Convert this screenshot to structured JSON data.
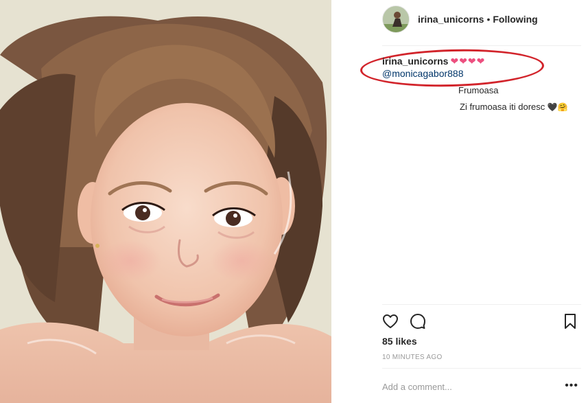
{
  "header": {
    "username": "irina_unicorns",
    "separator": "•",
    "follow_state": "Following",
    "avatar_icon": "avatar-photo"
  },
  "caption": {
    "username": "irina_unicorns",
    "hearts": "❤❤❤❤",
    "mention": "@monicagabor888"
  },
  "comments": [
    {
      "text": "Frumoasa"
    },
    {
      "text": "Zi frumoasa iti doresc",
      "emoji": "🖤🤗"
    }
  ],
  "actions": {
    "like_icon": "heart-outline-icon",
    "comment_icon": "speech-bubble-icon",
    "save_icon": "bookmark-icon"
  },
  "likes": "85 likes",
  "timestamp": "10 MINUTES AGO",
  "add_comment": {
    "placeholder": "Add a comment...",
    "more_label": "•••"
  },
  "colors": {
    "annotation_circle": "#d2242b",
    "hearts": "#ed4f7f",
    "mention_link": "#003569",
    "secondary_text": "#999999"
  }
}
